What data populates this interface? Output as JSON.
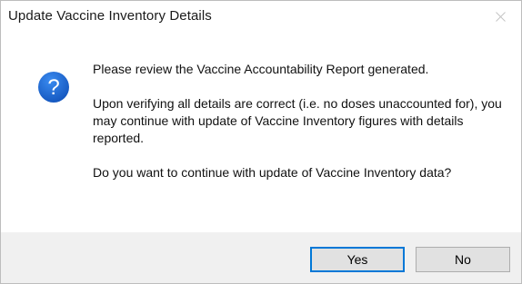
{
  "window": {
    "title": "Update Vaccine Inventory Details",
    "close_icon": "close-icon"
  },
  "message": {
    "icon": "question-icon",
    "paragraphs": [
      "Please review the Vaccine Accountability Report generated.",
      "Upon verifying all details are correct (i.e. no doses unaccounted for), you may continue with update of Vaccine Inventory figures with details reported.",
      "Do you want to continue with update of Vaccine Inventory data?"
    ]
  },
  "buttons": {
    "yes_label": "Yes",
    "no_label": "No",
    "default": "Yes"
  },
  "colors": {
    "icon_blue": "#1e6fd9",
    "focus_border": "#0078d7",
    "footer_bg": "#f0f0f0"
  }
}
